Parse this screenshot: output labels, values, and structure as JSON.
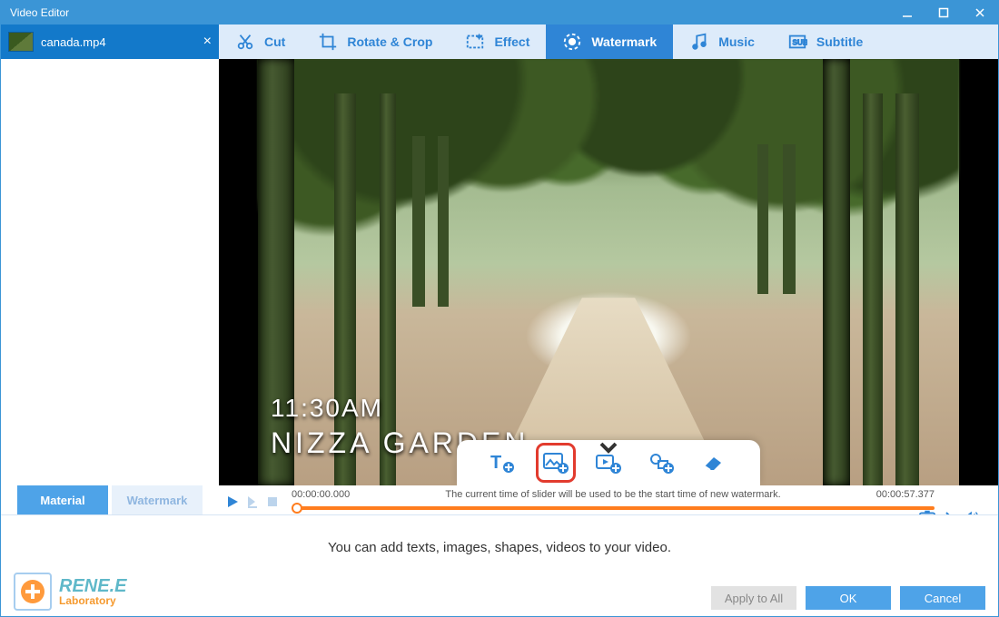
{
  "window": {
    "title": "Video Editor"
  },
  "file": {
    "name": "canada.mp4"
  },
  "sidebar_tabs": {
    "material": "Material",
    "watermark": "Watermark"
  },
  "toolbar": {
    "cut": "Cut",
    "rotate": "Rotate & Crop",
    "effect": "Effect",
    "watermark": "Watermark",
    "music": "Music",
    "subtitle": "Subtitle"
  },
  "overlay": {
    "line1": "11:30AM",
    "line2": "NIZZA GARDEN"
  },
  "timeline": {
    "start": "00:00:00.000",
    "end": "00:00:57.377",
    "hint": "The current time of slider will be used to be the start time of new watermark."
  },
  "help_text": "You can add texts, images, shapes, videos to your video.",
  "buttons": {
    "apply_all": "Apply to All",
    "ok": "OK",
    "cancel": "Cancel"
  },
  "brand": {
    "name": "RENE.E",
    "sub": "Laboratory"
  }
}
